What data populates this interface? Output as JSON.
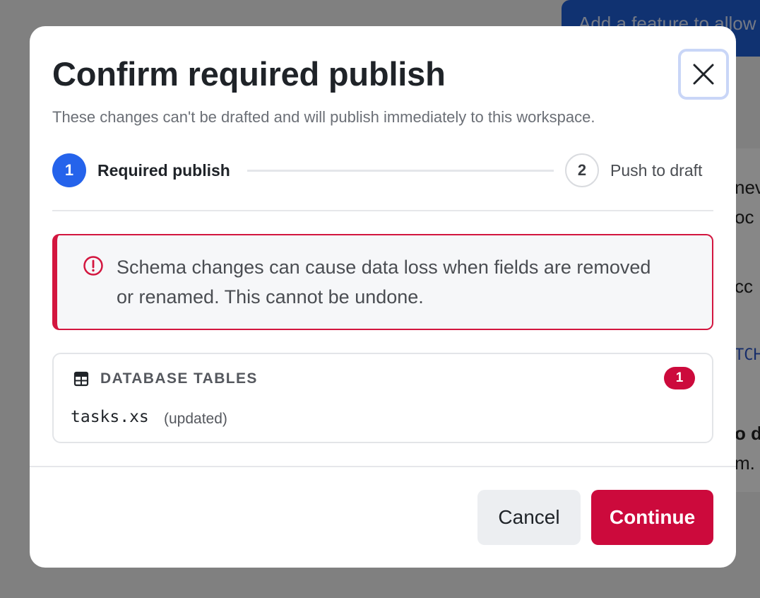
{
  "background": {
    "top_button_label": "Add a feature to allow",
    "card_fragments": [
      {
        "text": "nev",
        "style": "normal"
      },
      {
        "text": "oc",
        "style": "normal"
      },
      {
        "text": "cc",
        "style": "normal"
      },
      {
        "text": "TCH",
        "style": "mono"
      },
      {
        "text": "o d",
        "style": "bold"
      },
      {
        "text": "m.",
        "style": "normal"
      }
    ]
  },
  "modal": {
    "title": "Confirm required publish",
    "subtitle": "These changes can't be drafted and will publish immediately to this workspace.",
    "close_icon": "close-icon"
  },
  "stepper": {
    "steps": [
      {
        "number": "1",
        "label": "Required publish",
        "state": "active"
      },
      {
        "number": "2",
        "label": "Push to draft",
        "state": "inactive"
      }
    ]
  },
  "alert": {
    "icon": "alert-circle-icon",
    "message": "Schema changes can cause data loss when fields are removed or renamed. This cannot be undone."
  },
  "database_tables": {
    "icon": "table-icon",
    "title": "DATABASE TABLES",
    "count": "1",
    "items": [
      {
        "name": "tasks.xs",
        "status": "(updated)"
      }
    ]
  },
  "footer": {
    "cancel_label": "Cancel",
    "continue_label": "Continue"
  },
  "colors": {
    "accent": "#2563eb",
    "danger": "#cc0a3c",
    "alert_border": "#d3163f"
  }
}
